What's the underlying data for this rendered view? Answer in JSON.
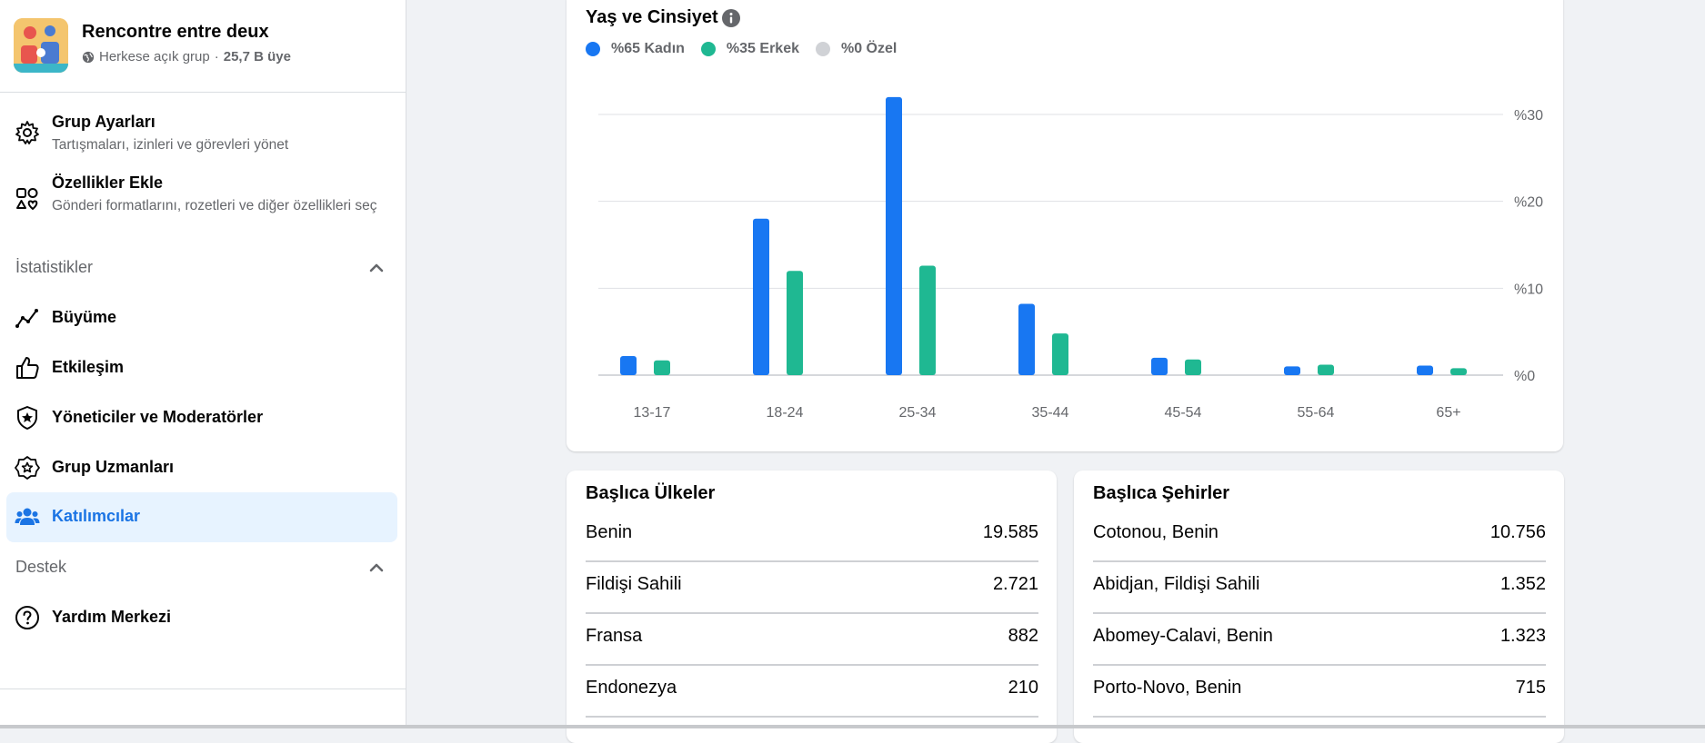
{
  "group": {
    "name": "Rencontre entre deux",
    "privacy": "Herkese açık grup",
    "separator": "·",
    "members": "25,7 B üye"
  },
  "sidebar": {
    "items": [
      {
        "title": "Grup Ayarları",
        "subtitle": "Tartışmaları, izinleri ve görevleri yönet",
        "icon": "gear-icon"
      },
      {
        "title": "Özellikler Ekle",
        "subtitle": "Gönderi formatlarını, rozetleri ve diğer özellikleri seç",
        "icon": "shapes-icon"
      }
    ],
    "stats_section": {
      "title": "İstatistikler",
      "items": [
        {
          "title": "Büyüme",
          "icon": "growth-chart-icon"
        },
        {
          "title": "Etkileşim",
          "icon": "thumbs-up-icon"
        },
        {
          "title": "Yöneticiler ve Moderatörler",
          "icon": "shield-star-icon"
        },
        {
          "title": "Grup Uzmanları",
          "icon": "expert-badge-icon"
        },
        {
          "title": "Katılımcılar",
          "icon": "people-icon",
          "active": true
        }
      ]
    },
    "support_section": {
      "title": "Destek",
      "items": [
        {
          "title": "Yardım Merkezi",
          "icon": "question-circle-icon"
        }
      ]
    }
  },
  "chart_card": {
    "title": "Yaş ve Cinsiyet",
    "legend": [
      {
        "label": "%65 Kadın",
        "color": "#1877f2"
      },
      {
        "label": "%35 Erkek",
        "color": "#1fb892"
      },
      {
        "label": "%0 Özel",
        "color": "#d0d2d6"
      }
    ]
  },
  "chart_data": {
    "type": "bar",
    "categories": [
      "13-17",
      "18-24",
      "25-34",
      "35-44",
      "45-54",
      "55-64",
      "65+"
    ],
    "series": [
      {
        "name": "%65 Kadın",
        "values": [
          2.2,
          18,
          32,
          8.2,
          2,
          1,
          1.1
        ],
        "color": "#1877f2"
      },
      {
        "name": "%35 Erkek",
        "values": [
          1.7,
          12,
          12.6,
          4.8,
          1.8,
          1.2,
          0.8
        ],
        "color": "#1fb892"
      }
    ],
    "y_ticks": [
      "%0",
      "%10",
      "%20",
      "%30"
    ],
    "ylim": [
      0,
      30
    ],
    "grid": true
  },
  "countries": {
    "title": "Başlıca Ülkeler",
    "rows": [
      {
        "name": "Benin",
        "value": "19.585"
      },
      {
        "name": "Fildişi Sahili",
        "value": "2.721"
      },
      {
        "name": "Fransa",
        "value": "882"
      },
      {
        "name": "Endonezya",
        "value": "210"
      }
    ]
  },
  "cities": {
    "title": "Başlıca Şehirler",
    "rows": [
      {
        "name": "Cotonou, Benin",
        "value": "10.756"
      },
      {
        "name": "Abidjan, Fildişi Sahili",
        "value": "1.352"
      },
      {
        "name": "Abomey-Calavi, Benin",
        "value": "1.323"
      },
      {
        "name": "Porto-Novo, Benin",
        "value": "715"
      }
    ]
  }
}
